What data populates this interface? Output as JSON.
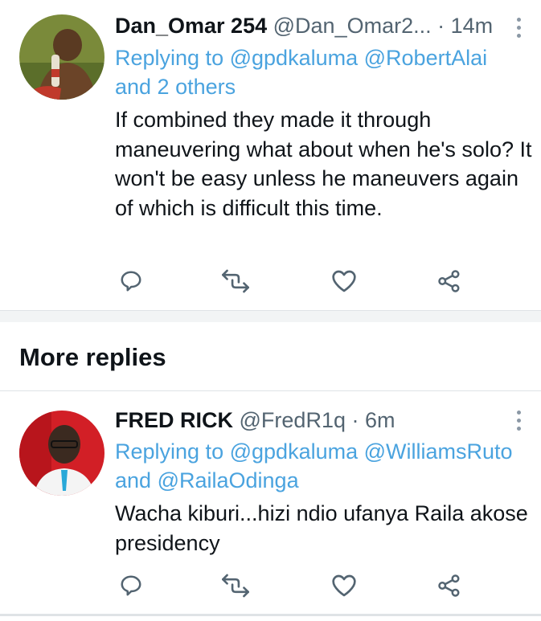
{
  "tweets": [
    {
      "name": "Dan_Omar 254",
      "handle": "@Dan_Omar2...",
      "dot": "·",
      "time": "14m",
      "replying_prefix": "Replying to",
      "mention1": "@gpdkaluma",
      "mention2": "@RobertAlai",
      "and_others": "and 2 others",
      "text": "If combined they made it through maneuvering what about when he's solo? It won't be easy unless he maneuvers again of which is difficult this time."
    },
    {
      "name": "FRED RICK",
      "handle": "@FredR1q",
      "dot": "·",
      "time": "6m",
      "replying_prefix": "Replying to",
      "mention1": "@gpdkaluma",
      "mention2": "@WilliamsRuto",
      "and_word": "and",
      "mention3": "@RailaOdinga",
      "text": "Wacha kiburi...hizi ndio ufanya Raila akose presidency"
    }
  ],
  "more_replies_title": "More replies",
  "icons": [
    "reply-icon",
    "retweet-icon",
    "like-icon",
    "share-icon",
    "more-icon"
  ],
  "colors": {
    "link": "#4aa3df",
    "icon": "#536471",
    "text": "#0f1419"
  }
}
